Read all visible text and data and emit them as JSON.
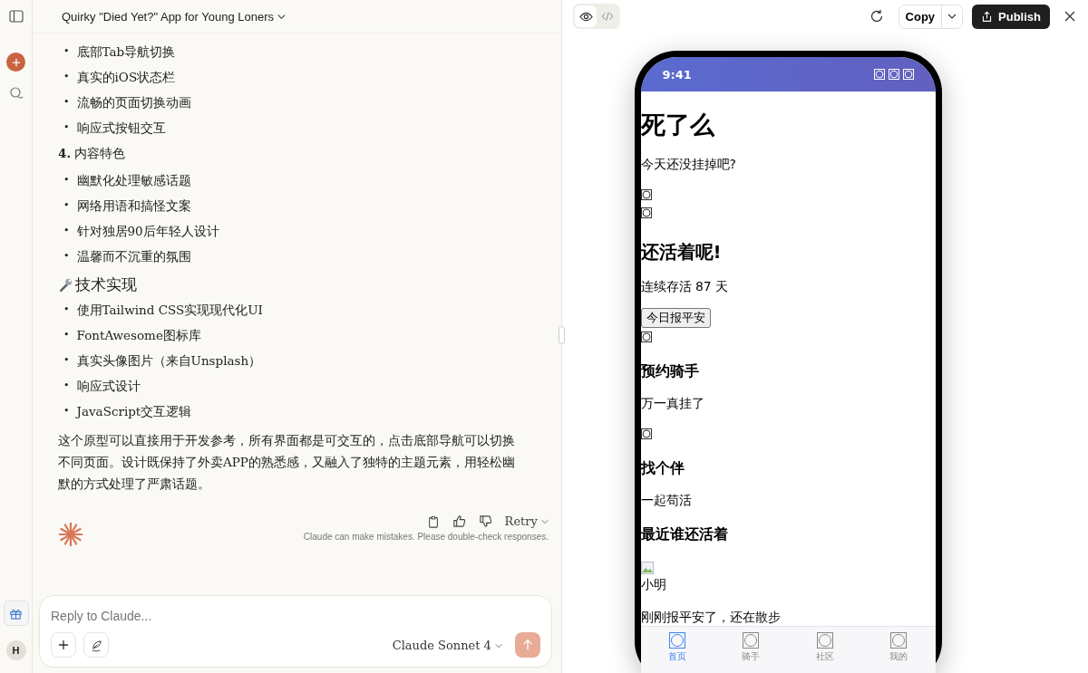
{
  "sidebar": {
    "avatar": "H"
  },
  "chat": {
    "title": "Quirky \"Died Yet?\" App for Young Loners",
    "blocks": [
      {
        "kind": "list",
        "marker": "•",
        "items": [
          "底部Tab导航切换",
          "真实的iOS状态栏",
          "流畅的页面切换动画",
          "响应式按钮交互"
        ]
      },
      {
        "kind": "heading",
        "text": "**4.** 内容特色"
      },
      {
        "kind": "list",
        "marker": "•",
        "items": [
          "幽默化处理敏感话题",
          "网络用语和搞怪文案",
          "针对独居90后年轻人设计",
          "温馨而不沉重的氛围"
        ]
      },
      {
        "kind": "section",
        "text": "技术实现"
      },
      {
        "kind": "list",
        "marker": "•",
        "items": [
          "使用Tailwind CSS实现现代化UI",
          "FontAwesome图标库",
          "真实头像图片（来自Unsplash）",
          "响应式设计",
          "JavaScript交互逻辑"
        ]
      },
      {
        "kind": "paragraph",
        "text": "这个原型可以直接用于开发参考，所有界面都是可交互的，点击底部导航可以切换不同页面。设计既保持了外卖APP的熟悉感，又融入了独特的主题元素，用轻松幽默的方式处理了严肃话题。"
      }
    ],
    "retry": "Retry",
    "disclaimer": "Claude can make mistakes. Please double-check responses.",
    "composer": {
      "placeholder": "Reply to Claude...",
      "model": "Claude Sonnet 4"
    }
  },
  "preview": {
    "views": [
      {
        "kind": "preview",
        "selected": true
      },
      {
        "kind": "code",
        "selected": false
      }
    ],
    "copy": "Copy",
    "publish": "Publish",
    "phone": {
      "time": "9:41",
      "content": [
        {
          "kind": "h1",
          "text": "死了么"
        },
        {
          "kind": "p",
          "text": "今天还没挂掉吧?"
        },
        {
          "kind": "glyph"
        },
        {
          "kind": "glyph"
        },
        {
          "kind": "h2",
          "text": "还活着呢!"
        },
        {
          "kind": "p",
          "text": "连续存活 87 天"
        },
        {
          "kind": "button",
          "text": "今日报平安"
        },
        {
          "kind": "glyph"
        },
        {
          "kind": "h3",
          "text": "预约骑手"
        },
        {
          "kind": "p",
          "text": "万一真挂了"
        },
        {
          "kind": "glyph"
        },
        {
          "kind": "h3",
          "text": "找个伴"
        },
        {
          "kind": "p",
          "text": "一起苟活"
        },
        {
          "kind": "h3",
          "text": "最近谁还活着"
        },
        {
          "kind": "image"
        },
        {
          "kind": "text",
          "text": "小明"
        },
        {
          "kind": "p",
          "text": "刚刚报平安了，还在散步"
        }
      ],
      "tabs": [
        {
          "label": "首页",
          "selected": true
        },
        {
          "label": "骑手",
          "selected": false
        },
        {
          "label": "社区",
          "selected": false
        },
        {
          "label": "我的",
          "selected": false
        }
      ]
    }
  }
}
